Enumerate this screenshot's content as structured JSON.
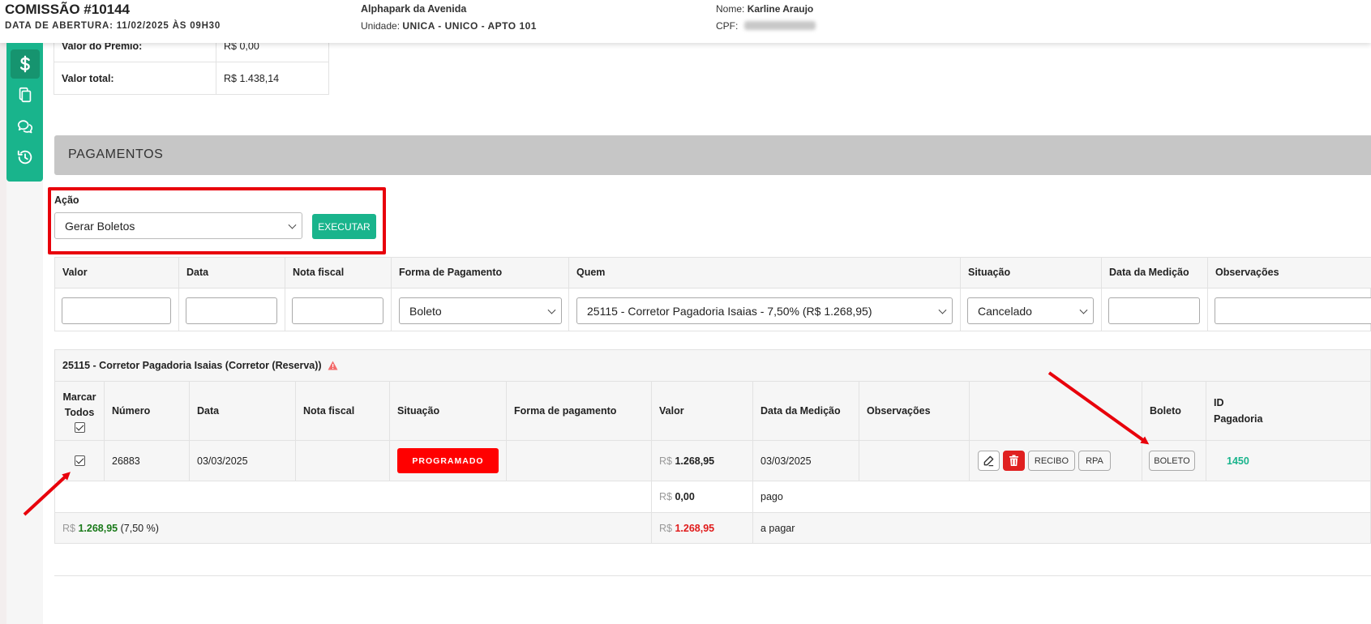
{
  "header": {
    "title": "COMISSÃO #10144",
    "opening_label": "DATA DE ABERTURA:",
    "opening_value": "11/02/2025 ÀS 09H30",
    "project": "Alphapark da Avenida",
    "unit_label": "Unidade:",
    "unit_value": "UNICA - UNICO - APTO 101",
    "name_label": "Nome:",
    "name_value": "Karline Araujo",
    "cpf_label": "CPF:"
  },
  "side_menu": {
    "icons": [
      "dollar-icon",
      "copy-icon",
      "chat-icon",
      "history-icon"
    ],
    "accent_color": "#19b48c"
  },
  "summary": {
    "rows": [
      {
        "label": "Valor do Prêmio:",
        "value": "R$ 0,00"
      },
      {
        "label": "Valor total:",
        "value": "R$ 1.438,14"
      }
    ]
  },
  "section": {
    "title": "PAGAMENTOS"
  },
  "acao": {
    "label": "Ação",
    "selected": "Gerar Boletos",
    "execute_label": "EXECUTAR"
  },
  "filters": {
    "headers": [
      "Valor",
      "Data",
      "Nota fiscal",
      "Forma de Pagamento",
      "Quem",
      "Situação",
      "Data da Medição",
      "Observações"
    ],
    "valor": "",
    "data": "",
    "nota_fiscal": "",
    "forma_pagamento": "Boleto",
    "quem": "25115 - Corretor Pagadoria Isaias - 7,50% (R$ 1.268,95)",
    "situacao": "Cancelado",
    "data_medicao": "",
    "observacoes": ""
  },
  "group": {
    "title": "25115 - Corretor Pagadoria Isaias (Corretor (Reserva))",
    "columns": {
      "marcar_todos": "Marcar Todos",
      "numero": "Número",
      "data": "Data",
      "nota_fiscal": "Nota fiscal",
      "situacao": "Situação",
      "forma_pagamento": "Forma de pagamento",
      "valor": "Valor",
      "data_medicao": "Data da Medição",
      "observacoes": "Observações",
      "acoes": "",
      "boleto": "Boleto",
      "id_pagadoria": "ID Pagadoria"
    },
    "payment": {
      "checked": true,
      "numero": "26883",
      "data": "03/03/2025",
      "nota_fiscal": "",
      "situacao": "PROGRAMADO",
      "forma_pagamento": "",
      "currency": "R$",
      "valor": "1.268,95",
      "data_medicao": "03/03/2025",
      "observacoes": "",
      "recibo_label": "RECIBO",
      "rpa_label": "RPA",
      "boleto_label": "BOLETO",
      "id_pagadoria": "1450"
    },
    "paid": {
      "currency": "R$",
      "value": "0,00",
      "label": "pago"
    },
    "total": {
      "currency": "R$",
      "value": "1.268,95",
      "percent": "(7,50 %)",
      "to_pay_currency": "R$",
      "to_pay_value": "1.268,95",
      "to_pay_label": "a pagar"
    }
  },
  "colors": {
    "accent": "#19b48c",
    "danger": "#ff0000",
    "highlight_box": "#e8000b"
  }
}
